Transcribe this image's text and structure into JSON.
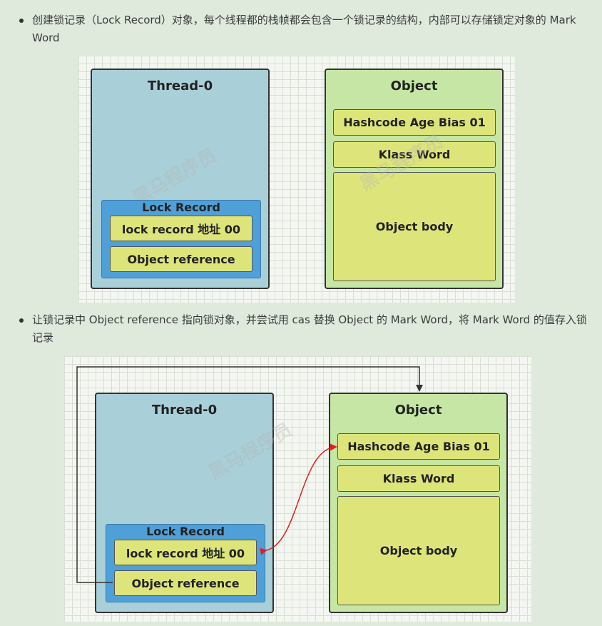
{
  "bullets": {
    "first": "创建锁记录（Lock Record）对象，每个线程都的栈帧都会包含一个锁记录的结构，内部可以存储锁定对象的 Mark Word",
    "second": "让锁记录中 Object reference 指向锁对象，并尝试用 cas 替换 Object 的 Mark Word，将 Mark Word 的值存入锁记录"
  },
  "diagram1": {
    "thread_title": "Thread-0",
    "lock_record_title": "Lock Record",
    "lock_record_slot": "lock record 地址 00",
    "object_reference": "Object reference",
    "object_title": "Object",
    "mark_word": "Hashcode Age Bias 01",
    "klass_word": "Klass Word",
    "object_body": "Object body"
  },
  "diagram2": {
    "thread_title": "Thread-0",
    "lock_record_title": "Lock Record",
    "lock_record_slot": "lock record 地址 00",
    "object_reference": "Object reference",
    "object_title": "Object",
    "mark_word": "Hashcode Age Bias 01",
    "klass_word": "Klass Word",
    "object_body": "Object body"
  },
  "watermark": "黑马程序员",
  "colors": {
    "thread_box": "#a9cfd8",
    "object_box": "#c5e6a4",
    "lock_record": "#4fa0d8",
    "slot": "#dde57a",
    "cas_arrow": "#e02020",
    "reference_arrow": "#333333"
  }
}
